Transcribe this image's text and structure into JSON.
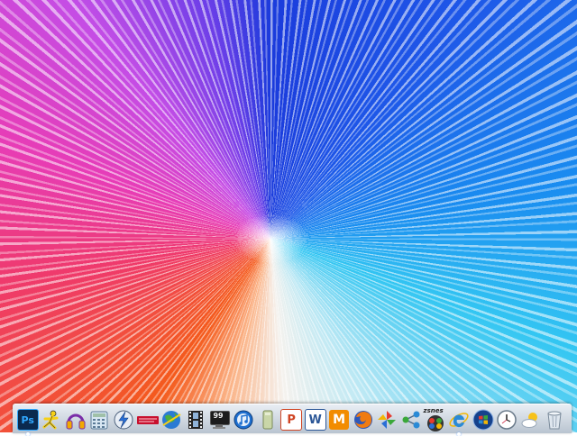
{
  "desktop": {
    "wallpaper_colors": [
      "#1b3bdc",
      "#33c6f2",
      "#f5f2ee",
      "#f45a1c",
      "#e73cb6",
      "#6b3ee8"
    ]
  },
  "dock": {
    "items": [
      {
        "icon": "photoshop-icon",
        "label": "Ps",
        "running": true
      },
      {
        "icon": "aim-runner-icon",
        "label": "",
        "running": false
      },
      {
        "icon": "headphones-icon",
        "label": "",
        "running": false
      },
      {
        "icon": "calculator-icon",
        "label": "",
        "running": false
      },
      {
        "icon": "lightning-icon",
        "label": "",
        "running": false
      },
      {
        "icon": "banner-app-icon",
        "label": "",
        "running": false
      },
      {
        "icon": "globe-icon",
        "label": "",
        "running": false
      },
      {
        "icon": "film-strip-icon",
        "label": "",
        "running": false
      },
      {
        "icon": "monitor-icon",
        "label": "99",
        "running": false
      },
      {
        "icon": "itunes-icon",
        "label": "",
        "running": false
      },
      {
        "icon": "folder-icon",
        "label": "",
        "running": false
      },
      {
        "icon": "powerpoint-icon",
        "label": "P",
        "running": false
      },
      {
        "icon": "word-icon",
        "label": "W",
        "running": false
      },
      {
        "icon": "m-app-icon",
        "label": "M",
        "running": false
      },
      {
        "icon": "firefox-icon",
        "label": "",
        "running": false
      },
      {
        "icon": "pinwheel-icon",
        "label": "",
        "running": false
      },
      {
        "icon": "network-icon",
        "label": "",
        "running": false
      },
      {
        "icon": "zsnes-icon",
        "label": "zsnes",
        "running": false
      },
      {
        "icon": "internet-explorer-icon",
        "label": "",
        "running": true
      },
      {
        "icon": "windows-start-icon",
        "label": "",
        "running": false
      },
      {
        "icon": "clock-icon",
        "label": "",
        "running": false
      },
      {
        "icon": "weather-icon",
        "label": "",
        "running": false
      },
      {
        "icon": "recycle-bin-icon",
        "label": "",
        "running": false
      }
    ]
  }
}
